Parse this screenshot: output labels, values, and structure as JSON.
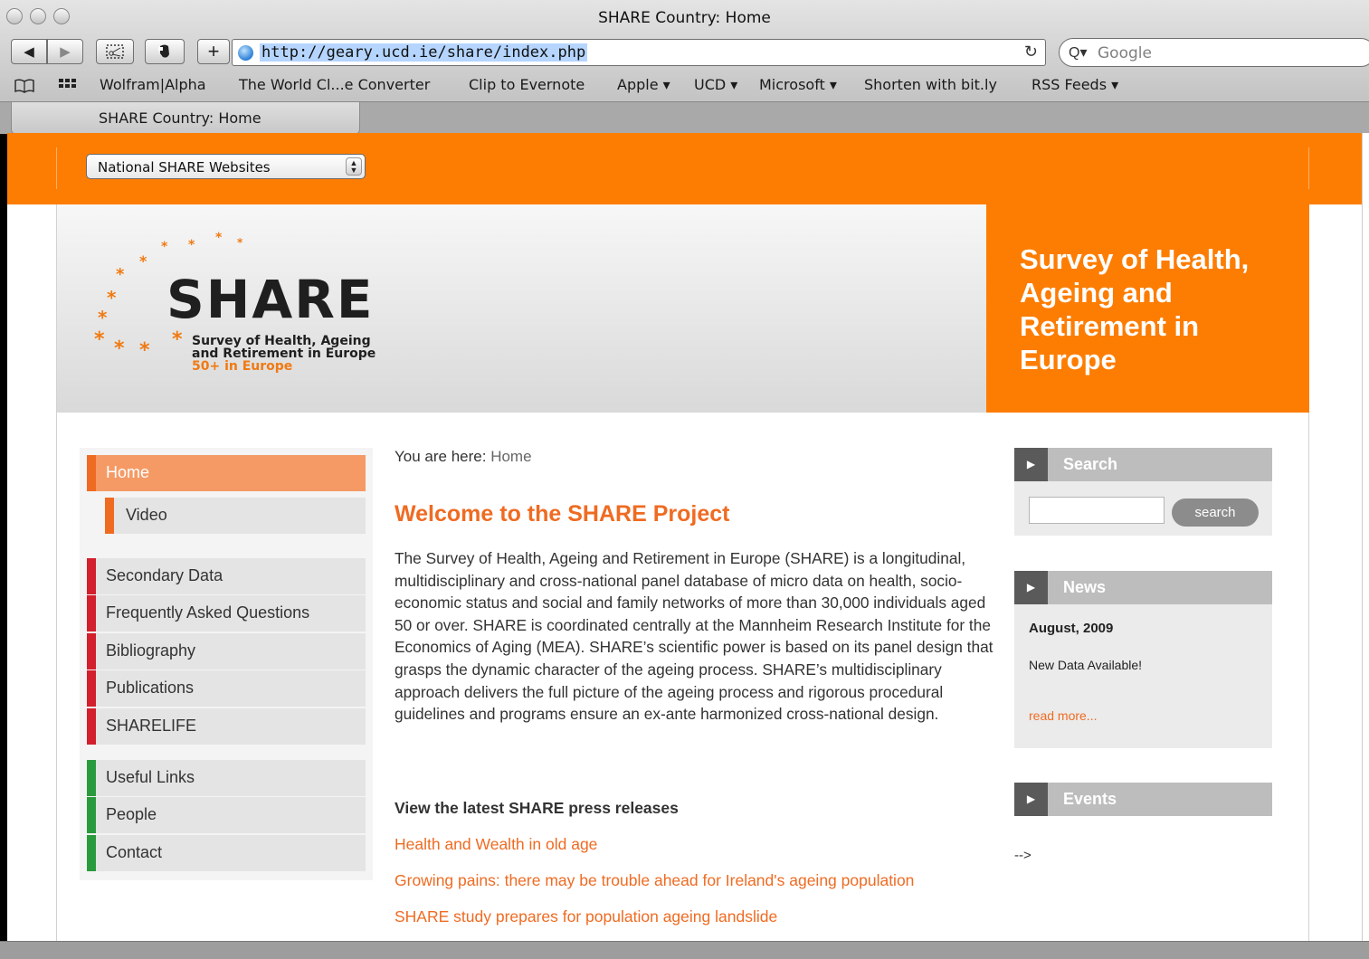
{
  "window": {
    "title": "SHARE Country: Home"
  },
  "toolbar": {
    "back_icon": "◀",
    "forward_icon": "▶",
    "add_icon": "+",
    "url": "http://geary.ucd.ie/share/index.php",
    "reload_icon": "↻",
    "search_placeholder": "Google",
    "search_icon": "Q▾"
  },
  "bookmarks": {
    "items": [
      "Wolfram|Alpha",
      "The World Cl...e Converter",
      "Clip to Evernote",
      "Apple ▾",
      "UCD ▾",
      "Microsoft ▾",
      "Shorten with bit.ly",
      "RSS Feeds ▾"
    ]
  },
  "tab": {
    "label": "SHARE Country: Home"
  },
  "site": {
    "national_select": "National SHARE Websites",
    "logo": {
      "word": "SHARE",
      "sub1": "Survey of Health, Ageing",
      "sub2": "and Retirement in Europe",
      "sub3": "50+ in Europe"
    },
    "tagline": "Survey of Health, Ageing and Retirement in Europe"
  },
  "nav": {
    "items": [
      "Home",
      "Video",
      "Secondary Data",
      "Frequently Asked Questions",
      "Bibliography",
      "Publications",
      "SHARELIFE",
      "Useful Links",
      "People",
      "Contact"
    ]
  },
  "content": {
    "breadcrumb_label": "You are here: ",
    "breadcrumb_current": "Home",
    "welcome": "Welcome to the SHARE Project",
    "intro": "The Survey of Health, Ageing and Retirement in Europe (SHARE) is a longitudinal, multidisciplinary and cross-national panel database of micro data on health, socio-economic status and social and family networks of more than 30,000 individuals aged 50 or over. SHARE is coordinated centrally at the Mannheim Research Institute for the Economics of Aging (MEA). SHARE’s scientific power is based on its panel design that grasps the dynamic character of the ageing process. SHARE’s multidisciplinary approach delivers the full picture of the ageing process and rigorous procedural guidelines and programs ensure an ex-ante harmonized cross-national design.",
    "press_heading": "View the latest SHARE press releases",
    "press_links": [
      "Health and Wealth in old age",
      "Growing pains: there may be trouble ahead for Ireland's ageing population",
      "SHARE study prepares for population ageing landslide"
    ]
  },
  "sidebar_right": {
    "search_title": "Search",
    "search_button": "search",
    "news_title": "News",
    "news_date": "August, 2009",
    "news_item": "New Data Available!",
    "news_more": "read more...",
    "events_title": "Events",
    "events_after": "-->"
  },
  "colors": {
    "accent": "#fd7d03",
    "link": "#ef6b22",
    "nav_red": "#d2202c",
    "nav_green": "#2a9b3c"
  }
}
